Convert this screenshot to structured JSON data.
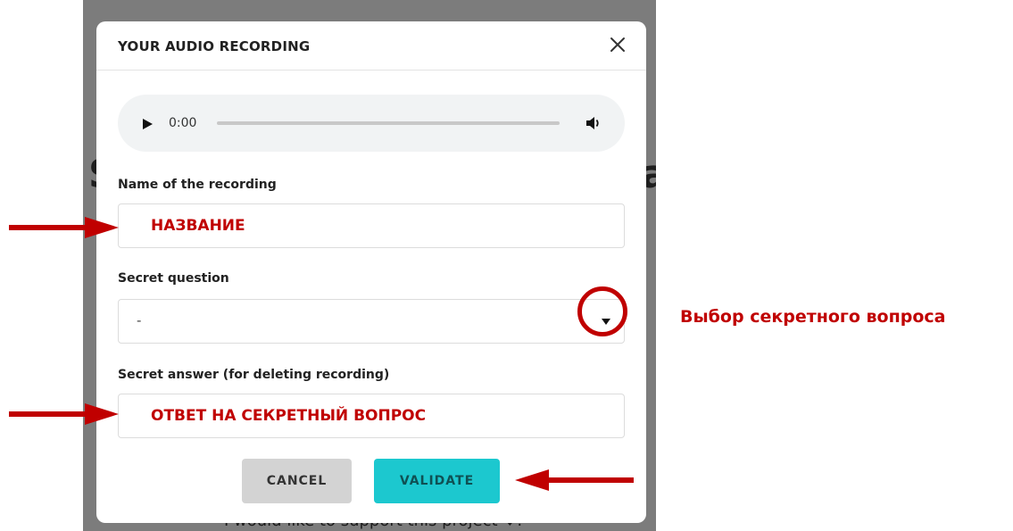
{
  "background": {
    "big_left": "S",
    "big_right": "a",
    "footer_text": "I would like to support this project ♥."
  },
  "modal": {
    "title": "YOUR AUDIO RECORDING",
    "close_icon": "close-icon"
  },
  "audio_player": {
    "time": "0:00",
    "progress": 0,
    "play_icon": "play-icon",
    "volume_icon": "volume-icon"
  },
  "form": {
    "name_label": "Name of the recording",
    "name_value": "НАЗВАНИЕ",
    "question_label": "Secret question",
    "question_selected": "-",
    "answer_label": "Secret answer (for deleting recording)",
    "answer_value": "ОТВЕТ НА СЕКРЕТНЫЙ ВОПРОС"
  },
  "buttons": {
    "cancel_label": "CANCEL",
    "validate_label": "VALIDATE"
  },
  "annotations": {
    "select_hint": "Выбор секретного вопроса",
    "color": "#c00000"
  },
  "colors": {
    "accent": "#1cc8cf",
    "cancel_bg": "#d3d3d3",
    "annotation": "#c00000"
  }
}
